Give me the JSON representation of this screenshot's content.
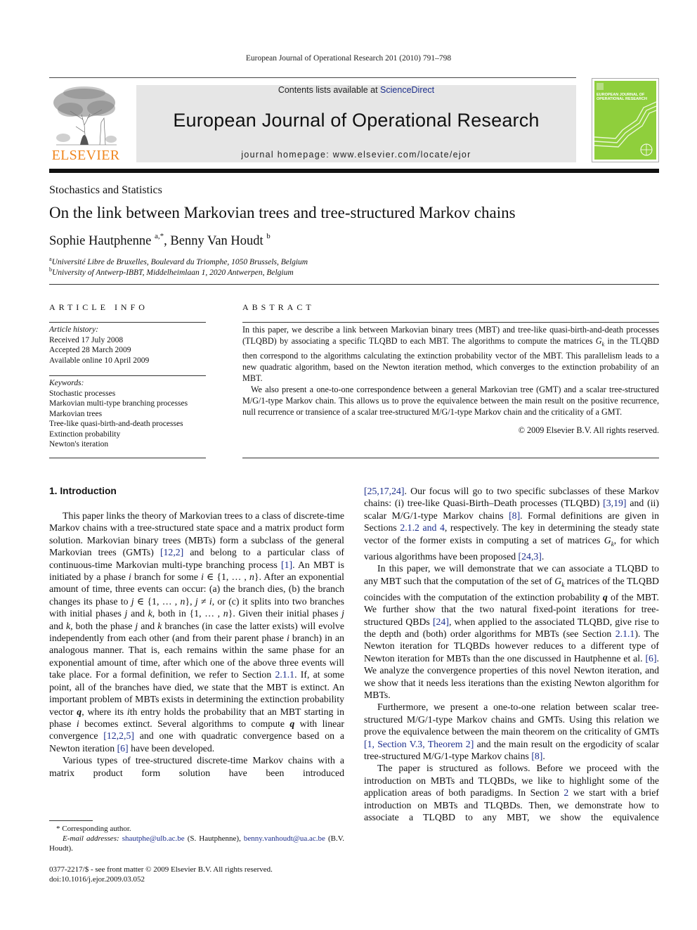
{
  "running_head": "European Journal of Operational Research 201 (2010) 791–798",
  "masthead": {
    "contents_prefix": "Contents lists available at ",
    "contents_link": "ScienceDirect",
    "journal_title": "European Journal of Operational Research",
    "homepage": "journal homepage: www.elsevier.com/locate/ejor",
    "publisher": "ELSEVIER",
    "cover_title_line1": "EUROPEAN JOURNAL OF",
    "cover_title_line2": "OPERATIONAL RESEARCH",
    "brand_color": "#f0861e",
    "cover_color": "#8fcf3c",
    "link_color": "#1c2e8c"
  },
  "article": {
    "section_kind": "Stochastics and Statistics",
    "title": "On the link between Markovian trees and tree-structured Markov chains",
    "authors": [
      {
        "name": "Sophie Hautphenne",
        "sup": "a,*"
      },
      {
        "name": "Benny Van Houdt",
        "sup": "b"
      }
    ],
    "author_separator": ", ",
    "affiliations": [
      {
        "sup": "a",
        "text": "Université Libre de Bruxelles, Boulevard du Triomphe, 1050 Brussels, Belgium"
      },
      {
        "sup": "b",
        "text": "University of Antwerp-IBBT, Middelheimlaan 1, 2020 Antwerpen, Belgium"
      }
    ]
  },
  "article_info": {
    "heading": "ARTICLE INFO",
    "history_label": "Article history:",
    "history": [
      "Received 17 July 2008",
      "Accepted 28 March 2009",
      "Available online 10 April 2009"
    ],
    "keywords_label": "Keywords:",
    "keywords": [
      "Stochastic processes",
      "Markovian multi-type branching processes",
      "Markovian trees",
      "Tree-like quasi-birth-and-death processes",
      "Extinction probability",
      "Newton's iteration"
    ]
  },
  "abstract": {
    "heading": "ABSTRACT",
    "p1_a": "In this paper, we describe a link between Markovian binary trees (MBT) and tree-like quasi-birth-and-death processes (TLQBD) by associating a specific TLQBD to each MBT. The algorithms to compute the matrices ",
    "p1_G": "G",
    "p1_k": "k",
    "p1_b": " in the TLQBD then correspond to the algorithms calculating the extinction probability vector of the MBT. This parallelism leads to a new quadratic algorithm, based on the Newton iteration method, which converges to the extinction probability of an MBT.",
    "p2": "We also present a one-to-one correspondence between a general Markovian tree (GMT) and a scalar tree-structured M/G/1-type Markov chain. This allows us to prove the equivalence between the main result on the positive recurrence, null recurrence or transience of a scalar tree-structured M/G/1-type Markov chain and the criticality of a GMT.",
    "copyright": "© 2009 Elsevier B.V. All rights reserved."
  },
  "introduction": {
    "heading": "1. Introduction",
    "left": {
      "p1": [
        {
          "t": "This paper links the theory of Markovian trees to a class of discrete-time Markov chains with a tree-structured state space and a matrix product form solution. Markovian binary trees (MBTs) form a subclass of the general Markovian trees (GMTs) "
        },
        {
          "l": "[12,2]"
        },
        {
          "t": " and belong to a particular class of continuous-time Markovian multi-type branching process "
        },
        {
          "l": "[1]"
        },
        {
          "t": ". An MBT is initiated by a phase "
        },
        {
          "i": "i"
        },
        {
          "t": " branch for some "
        },
        {
          "i": "i"
        },
        {
          "t": " ∈ {1, … , "
        },
        {
          "i": "n"
        },
        {
          "t": "}. After an exponential amount of time, three events can occur: (a) the branch dies, (b) the branch changes its phase to "
        },
        {
          "i": "j"
        },
        {
          "t": " ∈ {1, … , "
        },
        {
          "i": "n"
        },
        {
          "t": "}, "
        },
        {
          "i": "j"
        },
        {
          "t": " ≠ "
        },
        {
          "i": "i"
        },
        {
          "t": ", or (c) it splits into two branches with initial phases "
        },
        {
          "i": "j"
        },
        {
          "t": " and "
        },
        {
          "i": "k"
        },
        {
          "t": ", both in {1, … , "
        },
        {
          "i": "n"
        },
        {
          "t": "}. Given their initial phases "
        },
        {
          "i": "j"
        },
        {
          "t": " and "
        },
        {
          "i": "k"
        },
        {
          "t": ", both the phase "
        },
        {
          "i": "j"
        },
        {
          "t": " and "
        },
        {
          "i": "k"
        },
        {
          "t": " branches (in case the latter exists) will evolve independently from each other (and from their parent phase "
        },
        {
          "i": "i"
        },
        {
          "t": " branch) in an analogous manner. That is, each remains within the same phase for an exponential amount of time, after which one of the above three events will take place. For a formal definition, we refer to Section "
        },
        {
          "l": "2.1.1"
        },
        {
          "t": ". If, at some point, all of the branches have died, we state that the MBT is extinct. An important problem of MBTs exists in determining the extinction probability vector "
        },
        {
          "b": "q"
        },
        {
          "t": ", where its "
        },
        {
          "i": "i"
        },
        {
          "t": "th entry holds the probability that an MBT starting in phase "
        },
        {
          "i": "i"
        },
        {
          "t": " becomes extinct. Several algorithms to compute "
        },
        {
          "b": "q"
        },
        {
          "t": " with linear convergence "
        },
        {
          "l": "[12,2,5]"
        },
        {
          "t": " and one with quadratic convergence based on a Newton iteration "
        },
        {
          "l": "[6]"
        },
        {
          "t": " have been developed."
        }
      ],
      "p2": [
        {
          "t": "Various types of tree-structured discrete-time Markov chains with a matrix product form solution have been introduced"
        }
      ]
    },
    "right": {
      "p0": [
        {
          "l": "[25,17,24]"
        },
        {
          "t": ". Our focus will go to two specific subclasses of these Markov chains: (i) tree-like Quasi-Birth–Death processes (TLQBD) "
        },
        {
          "l": "[3,19]"
        },
        {
          "t": " and (ii) scalar M/G/1-type Markov chains "
        },
        {
          "l": "[8]"
        },
        {
          "t": ". Formal definitions are given in Sections "
        },
        {
          "l": "2.1.2 and 4"
        },
        {
          "t": ", respectively. The key in determining the steady state vector of the former exists in computing a set of matrices "
        },
        {
          "i": "G"
        },
        {
          "s": "k"
        },
        {
          "t": ", for which various algorithms have been proposed "
        },
        {
          "l": "[24,3]"
        },
        {
          "t": "."
        }
      ],
      "p1": [
        {
          "t": "In this paper, we will demonstrate that we can associate a TLQBD to any MBT such that the computation of the set of "
        },
        {
          "i": "G"
        },
        {
          "s": "k"
        },
        {
          "t": " matrices of the TLQBD coincides with the computation of the extinction probability "
        },
        {
          "b": "q"
        },
        {
          "t": " of the MBT. We further show that the two natural fixed-point iterations for tree-structured QBDs "
        },
        {
          "l": "[24]"
        },
        {
          "t": ", when applied to the associated TLQBD, give rise to the depth and (both) order algorithms for MBTs (see Section "
        },
        {
          "l": "2.1.1"
        },
        {
          "t": "). The Newton iteration for TLQBDs however reduces to a different type of Newton iteration for MBTs than the one discussed in Hautphenne et al. "
        },
        {
          "l": "[6]"
        },
        {
          "t": ". We analyze the convergence properties of this novel Newton iteration, and we show that it needs less iterations than the existing Newton algorithm for MBTs."
        }
      ],
      "p2": [
        {
          "t": "Furthermore, we present a one-to-one relation between scalar tree-structured M/G/1-type Markov chains and GMTs. Using this relation we prove the equivalence between the main theorem on the criticality of GMTs "
        },
        {
          "l": "[1, Section V.3, Theorem 2]"
        },
        {
          "t": " and the main result on the ergodicity of scalar tree-structured M/G/1-type Markov chains "
        },
        {
          "l": "[8]"
        },
        {
          "t": "."
        }
      ],
      "p3": [
        {
          "t": "The paper is structured as follows. Before we proceed with the introduction on MBTs and TLQBDs, we like to highlight some of the application areas of both paradigms. In Section "
        },
        {
          "l": "2"
        },
        {
          "t": " we start with a brief introduction on MBTs and TLQBDs. Then, we demonstrate how to associate a TLQBD to any MBT, we show the equivalence"
        }
      ]
    }
  },
  "footnotes": {
    "corresponding": "* Corresponding author.",
    "email_label": "E-mail addresses:",
    "email1": "shautphe@ulb.ac.be",
    "email1_name": " (S. Hautphenne), ",
    "email2": "benny.vanhoudt@ua.ac.be",
    "email2_name": " (B.V. Houdt)."
  },
  "front_matter": {
    "issn_line": "0377-2217/$ - see front matter © 2009 Elsevier B.V. All rights reserved.",
    "doi": "doi:10.1016/j.ejor.2009.03.052"
  }
}
